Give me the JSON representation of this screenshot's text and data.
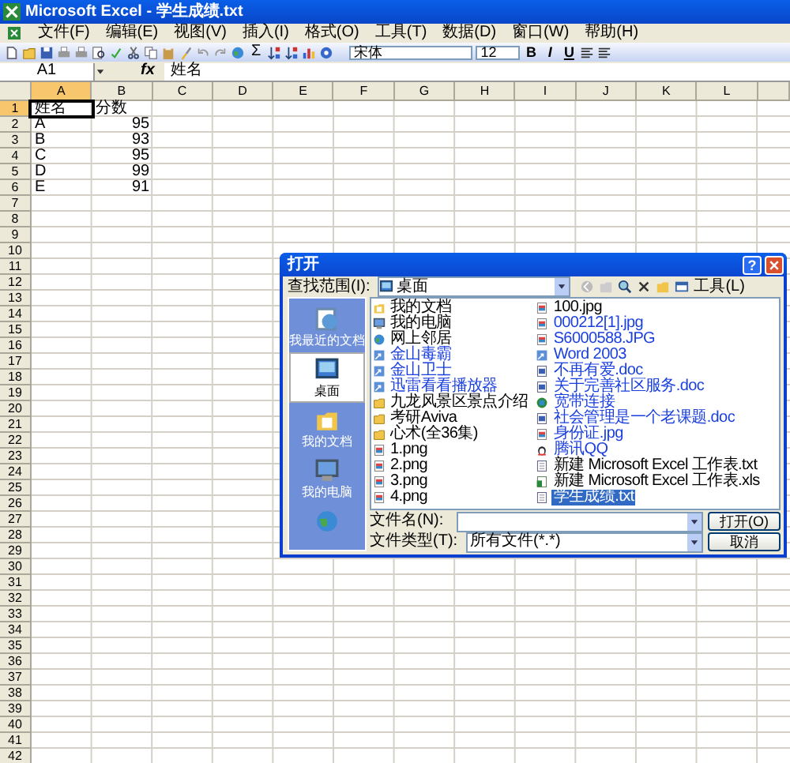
{
  "window": {
    "title": "Microsoft Excel - 学生成绩.txt"
  },
  "menu": [
    {
      "label": "文件(F)"
    },
    {
      "label": "编辑(E)"
    },
    {
      "label": "视图(V)"
    },
    {
      "label": "插入(I)"
    },
    {
      "label": "格式(O)"
    },
    {
      "label": "工具(T)"
    },
    {
      "label": "数据(D)"
    },
    {
      "label": "窗口(W)"
    },
    {
      "label": "帮助(H)"
    }
  ],
  "toolbar": {
    "sum": "Σ",
    "font": "宋体",
    "size": "12",
    "format_buttons": [
      "B",
      "I",
      "U"
    ]
  },
  "formula_bar": {
    "name_box": "A1",
    "function_label": "fx",
    "value": "姓名"
  },
  "table": {
    "columns": [
      {
        "label": "A",
        "selected": true
      },
      {
        "label": "B",
        "selected": false
      },
      {
        "label": "C",
        "selected": false
      },
      {
        "label": "D",
        "selected": false
      },
      {
        "label": "E",
        "selected": false
      },
      {
        "label": "F",
        "selected": false
      },
      {
        "label": "G",
        "selected": false
      },
      {
        "label": "H",
        "selected": false
      },
      {
        "label": "I",
        "selected": false
      },
      {
        "label": "J",
        "selected": false
      },
      {
        "label": "K",
        "selected": false
      },
      {
        "label": "L",
        "selected": false
      }
    ],
    "rows": [
      {
        "number": "1",
        "selected": true,
        "cells": [
          {
            "text": "姓名",
            "kind": "text"
          },
          {
            "text": "分数",
            "kind": "text"
          }
        ]
      },
      {
        "number": "2",
        "selected": false,
        "cells": [
          {
            "text": "A",
            "kind": "text"
          },
          {
            "text": "95",
            "kind": "number"
          }
        ]
      },
      {
        "number": "3",
        "selected": false,
        "cells": [
          {
            "text": "B",
            "kind": "text"
          },
          {
            "text": "93",
            "kind": "number"
          }
        ]
      },
      {
        "number": "4",
        "selected": false,
        "cells": [
          {
            "text": "C",
            "kind": "text"
          },
          {
            "text": "95",
            "kind": "number"
          }
        ]
      },
      {
        "number": "5",
        "selected": false,
        "cells": [
          {
            "text": "D",
            "kind": "text"
          },
          {
            "text": "99",
            "kind": "number"
          }
        ]
      },
      {
        "number": "6",
        "selected": false,
        "cells": [
          {
            "text": "E",
            "kind": "text"
          },
          {
            "text": "91",
            "kind": "number"
          }
        ]
      },
      {
        "number": "7",
        "selected": false
      },
      {
        "number": "8",
        "selected": false
      },
      {
        "number": "9",
        "selected": false
      },
      {
        "number": "10",
        "selected": false
      },
      {
        "number": "11",
        "selected": false
      },
      {
        "number": "12",
        "selected": false
      },
      {
        "number": "13",
        "selected": false
      },
      {
        "number": "14",
        "selected": false
      },
      {
        "number": "15",
        "selected": false
      },
      {
        "number": "16",
        "selected": false
      },
      {
        "number": "17",
        "selected": false
      },
      {
        "number": "18",
        "selected": false
      },
      {
        "number": "19",
        "selected": false
      },
      {
        "number": "20",
        "selected": false
      },
      {
        "number": "21",
        "selected": false
      },
      {
        "number": "22",
        "selected": false
      },
      {
        "number": "23",
        "selected": false
      },
      {
        "number": "24",
        "selected": false
      },
      {
        "number": "25",
        "selected": false
      },
      {
        "number": "26",
        "selected": false
      },
      {
        "number": "27",
        "selected": false
      },
      {
        "number": "28",
        "selected": false
      },
      {
        "number": "29",
        "selected": false
      },
      {
        "number": "30",
        "selected": false
      },
      {
        "number": "31",
        "selected": false
      },
      {
        "number": "32",
        "selected": false
      },
      {
        "number": "33",
        "selected": false
      },
      {
        "number": "34",
        "selected": false
      },
      {
        "number": "35",
        "selected": false
      },
      {
        "number": "36",
        "selected": false
      },
      {
        "number": "37",
        "selected": false
      },
      {
        "number": "38",
        "selected": false
      },
      {
        "number": "39",
        "selected": false
      },
      {
        "number": "40",
        "selected": false
      },
      {
        "number": "41",
        "selected": false
      },
      {
        "number": "42",
        "selected": false
      }
    ]
  },
  "dialog": {
    "title": "打开",
    "help": "?",
    "look_in_label": "查找范围(I):",
    "look_in_value": "桌面",
    "tools": "工具(L)",
    "places": [
      {
        "label": "我最近的文档",
        "kind": "recent",
        "selected": false
      },
      {
        "label": "桌面",
        "kind": "desktop",
        "selected": true
      },
      {
        "label": "我的文档",
        "kind": "documents",
        "selected": false
      },
      {
        "label": "我的电脑",
        "kind": "computer",
        "selected": false
      },
      {
        "kind": "network",
        "selected": false
      }
    ],
    "files": [
      {
        "name": "我的文档",
        "kind": "documents",
        "compressed": false,
        "selected": false
      },
      {
        "name": "我的电脑",
        "kind": "computer",
        "compressed": false,
        "selected": false
      },
      {
        "name": "网上邻居",
        "kind": "network",
        "compressed": false,
        "selected": false
      },
      {
        "name": "金山毒霸",
        "kind": "shortcut",
        "compressed": true,
        "selected": false
      },
      {
        "name": "金山卫士",
        "kind": "shortcut",
        "compressed": true,
        "selected": false
      },
      {
        "name": "迅雷看看播放器",
        "kind": "shortcut",
        "compressed": true,
        "selected": false
      },
      {
        "name": "九龙风景区景点介绍",
        "kind": "folder",
        "compressed": false,
        "selected": false
      },
      {
        "name": "考研Aviva",
        "kind": "folder",
        "compressed": false,
        "selected": false
      },
      {
        "name": "心术(全36集)",
        "kind": "folder",
        "compressed": false,
        "selected": false
      },
      {
        "name": "1.png",
        "kind": "image",
        "compressed": false,
        "selected": false
      },
      {
        "name": "2.png",
        "kind": "image",
        "compressed": false,
        "selected": false
      },
      {
        "name": "3.png",
        "kind": "image",
        "compressed": false,
        "selected": false
      },
      {
        "name": "4.png",
        "kind": "image",
        "compressed": false,
        "selected": false
      },
      {
        "name": "100.jpg",
        "kind": "image",
        "compressed": false,
        "selected": false
      },
      {
        "name": "000212[1].jpg",
        "kind": "image",
        "compressed": true,
        "selected": false
      },
      {
        "name": "S6000588.JPG",
        "kind": "image",
        "compressed": true,
        "selected": false
      },
      {
        "name": "Word 2003",
        "kind": "shortcut",
        "compressed": true,
        "selected": false
      },
      {
        "name": "不再有爱.doc",
        "kind": "doc",
        "compressed": true,
        "selected": false
      },
      {
        "name": "关于完善社区服务.doc",
        "kind": "doc",
        "compressed": true,
        "selected": false
      },
      {
        "name": "宽带连接",
        "kind": "connection",
        "compressed": true,
        "selected": false
      },
      {
        "name": "社会管理是一个老课题.doc",
        "kind": "doc",
        "compressed": true,
        "selected": false
      },
      {
        "name": "身份证.jpg",
        "kind": "image",
        "compressed": true,
        "selected": false
      },
      {
        "name": "腾讯QQ",
        "kind": "chat",
        "compressed": true,
        "selected": false
      },
      {
        "name": "新建 Microsoft Excel 工作表.txt",
        "kind": "text",
        "compressed": false,
        "selected": false
      },
      {
        "name": "新建 Microsoft Excel 工作表.xls",
        "kind": "sheet",
        "compressed": false,
        "selected": false
      },
      {
        "name": "学生成绩.txt",
        "kind": "text",
        "compressed": false,
        "selected": true
      }
    ],
    "file_name_label": "文件名(N):",
    "file_type_label": "文件类型(T):",
    "file_type_value": "所有文件(*.*)",
    "buttons": [
      {
        "label": "打开(O)",
        "kind": "open"
      },
      {
        "label": "取消",
        "kind": "cancel"
      }
    ]
  }
}
